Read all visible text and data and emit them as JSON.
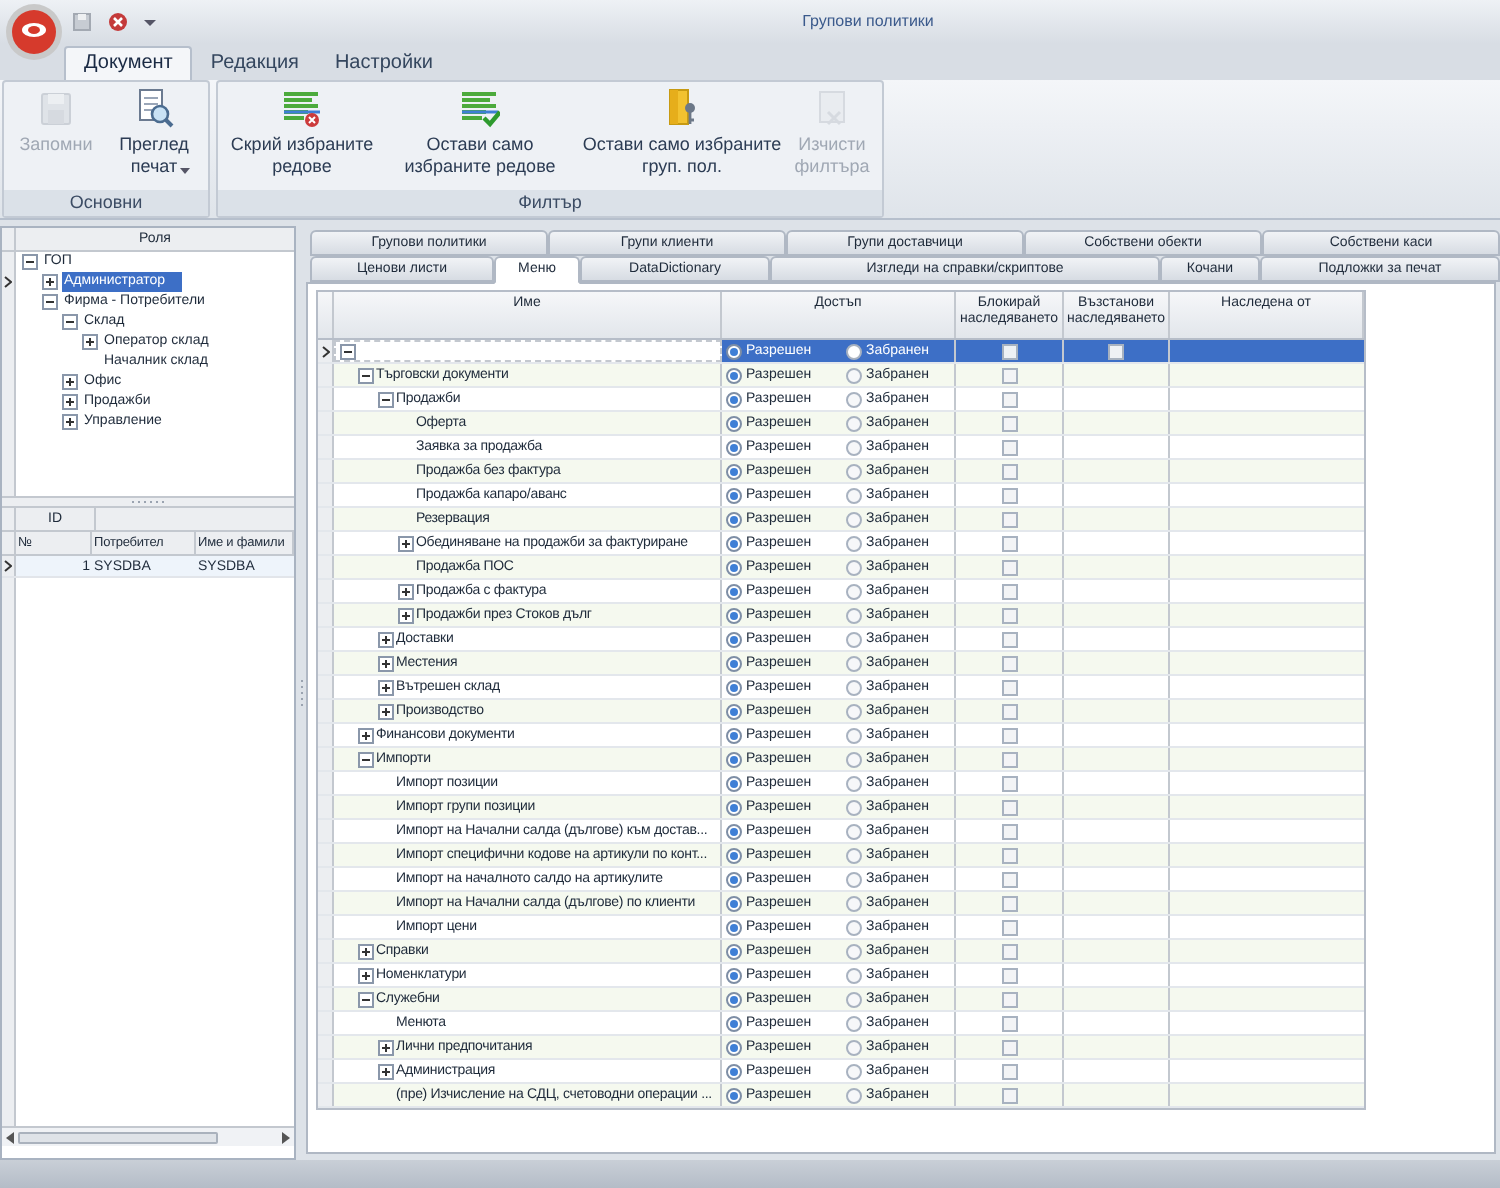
{
  "window": {
    "title": "Групови политики"
  },
  "ribbon": {
    "tabs": [
      {
        "label": "Документ",
        "selected": true
      },
      {
        "label": "Редакция",
        "selected": false
      },
      {
        "label": "Настройки",
        "selected": false
      }
    ],
    "groups": [
      {
        "label": "Основни",
        "buttons": [
          {
            "kind": "save",
            "label": "Запомни",
            "disabled": true
          },
          {
            "kind": "preview",
            "label": "Преглед печат",
            "disabled": false,
            "dropdown": true
          }
        ]
      },
      {
        "label": "Филтър",
        "buttons": [
          {
            "kind": "hide",
            "label": "Скрий избраните редове",
            "disabled": false
          },
          {
            "kind": "keep",
            "label": "Остави само избраните редове",
            "disabled": false
          },
          {
            "kind": "keepgroup",
            "label": "Остави само избраните груп. пол.",
            "disabled": false
          },
          {
            "kind": "clear",
            "label": "Изчисти филтъра",
            "disabled": true
          }
        ]
      }
    ]
  },
  "roles": {
    "header": "Роля",
    "items": [
      {
        "label": "ГОП",
        "expanded": true,
        "selected": false,
        "children": [
          {
            "label": "Администратор",
            "expanded": false,
            "selected": true
          },
          {
            "label": "Фирма - Потребители",
            "expanded": true,
            "selected": false,
            "children": [
              {
                "label": "Склад",
                "expanded": true,
                "selected": false,
                "children": [
                  {
                    "label": "Оператор склад",
                    "expanded": false,
                    "selected": false
                  },
                  {
                    "label": "Началник склад",
                    "selected": false
                  }
                ]
              },
              {
                "label": "Офис",
                "expanded": false,
                "selected": false
              },
              {
                "label": "Продажби",
                "expanded": false,
                "selected": false
              },
              {
                "label": "Управление",
                "expanded": false,
                "selected": false
              }
            ]
          }
        ]
      }
    ]
  },
  "users": {
    "band": "ID",
    "columns": [
      "№",
      "Потребител",
      "Име и фамили"
    ],
    "rows": [
      {
        "cells": [
          "1",
          "SYSDBA",
          "SYSDBA"
        ],
        "selected": true
      }
    ]
  },
  "tab_rows": [
    [
      {
        "label": "Групови политики",
        "selected": false
      },
      {
        "label": "Групи клиенти",
        "selected": false
      },
      {
        "label": "Групи доставчици",
        "selected": false
      },
      {
        "label": "Собствени обекти",
        "selected": false
      },
      {
        "label": "Собствени каси",
        "selected": false
      }
    ],
    [
      {
        "label": "Ценови листи",
        "selected": false
      },
      {
        "label": "Меню",
        "selected": true
      },
      {
        "label": "DataDictionary",
        "selected": false
      },
      {
        "label": "Изгледи на справки/скриптове",
        "selected": false
      },
      {
        "label": "Кочани",
        "selected": false
      },
      {
        "label": "Подложки за печат",
        "selected": false
      }
    ]
  ],
  "grid": {
    "columns": [
      "Име",
      "Достъп",
      "Блокирай наследяването",
      "Възстанови наследяването",
      "Наследена от"
    ],
    "rows": [
      {
        "expanded": true,
        "selected": true,
        "access": [
          {
            "label": "Разрешен",
            "selected": true
          },
          {
            "label": "Забранен",
            "selected": false
          }
        ],
        "block_inheritance": false,
        "restore_inheritance": false,
        "children": [
          {
            "label": "Търговски документи",
            "expanded": true,
            "selected": false,
            "access": [
              {
                "label": "Разрешен",
                "selected": true
              },
              {
                "label": "Забранен",
                "selected": false
              }
            ],
            "block_inheritance": false,
            "children": [
              {
                "label": "Продажби",
                "expanded": true,
                "selected": false,
                "access": [
                  {
                    "label": "Разрешен",
                    "selected": true
                  },
                  {
                    "label": "Забранен",
                    "selected": false
                  }
                ],
                "block_inheritance": false,
                "children": [
                  {
                    "label": "Оферта",
                    "selected": false,
                    "access": [
                      {
                        "label": "Разрешен",
                        "selected": true
                      },
                      {
                        "label": "Забранен",
                        "selected": false
                      }
                    ],
                    "block_inheritance": false
                  },
                  {
                    "label": "Заявка за продажба",
                    "selected": false,
                    "access": [
                      {
                        "label": "Разрешен",
                        "selected": true
                      },
                      {
                        "label": "Забранен",
                        "selected": false
                      }
                    ],
                    "block_inheritance": false
                  },
                  {
                    "label": "Продажба без фактура",
                    "selected": false,
                    "access": [
                      {
                        "label": "Разрешен",
                        "selected": true
                      },
                      {
                        "label": "Забранен",
                        "selected": false
                      }
                    ],
                    "block_inheritance": false
                  },
                  {
                    "label": "Продажба капаро/аванс",
                    "selected": false,
                    "access": [
                      {
                        "label": "Разрешен",
                        "selected": true
                      },
                      {
                        "label": "Забранен",
                        "selected": false
                      }
                    ],
                    "block_inheritance": false
                  },
                  {
                    "label": "Резервация",
                    "selected": false,
                    "access": [
                      {
                        "label": "Разрешен",
                        "selected": true
                      },
                      {
                        "label": "Забранен",
                        "selected": false
                      }
                    ],
                    "block_inheritance": false
                  },
                  {
                    "label": "Обединяване на продажби за фактуриране",
                    "expanded": false,
                    "selected": false,
                    "access": [
                      {
                        "label": "Разрешен",
                        "selected": true
                      },
                      {
                        "label": "Забранен",
                        "selected": false
                      }
                    ],
                    "block_inheritance": false
                  },
                  {
                    "label": "Продажба ПОС",
                    "selected": false,
                    "access": [
                      {
                        "label": "Разрешен",
                        "selected": true
                      },
                      {
                        "label": "Забранен",
                        "selected": false
                      }
                    ],
                    "block_inheritance": false
                  },
                  {
                    "label": "Продажба с фактура",
                    "expanded": false,
                    "selected": false,
                    "access": [
                      {
                        "label": "Разрешен",
                        "selected": true
                      },
                      {
                        "label": "Забранен",
                        "selected": false
                      }
                    ],
                    "block_inheritance": false
                  },
                  {
                    "label": "Продажби през Стоков дълг",
                    "expanded": false,
                    "selected": false,
                    "access": [
                      {
                        "label": "Разрешен",
                        "selected": true
                      },
                      {
                        "label": "Забранен",
                        "selected": false
                      }
                    ],
                    "block_inheritance": false
                  }
                ]
              },
              {
                "label": "Доставки",
                "expanded": false,
                "selected": false,
                "access": [
                  {
                    "label": "Разрешен",
                    "selected": true
                  },
                  {
                    "label": "Забранен",
                    "selected": false
                  }
                ],
                "block_inheritance": false
              },
              {
                "label": "Местения",
                "expanded": false,
                "selected": false,
                "access": [
                  {
                    "label": "Разрешен",
                    "selected": true
                  },
                  {
                    "label": "Забранен",
                    "selected": false
                  }
                ],
                "block_inheritance": false
              },
              {
                "label": "Вътрешен склад",
                "expanded": false,
                "selected": false,
                "access": [
                  {
                    "label": "Разрешен",
                    "selected": true
                  },
                  {
                    "label": "Забранен",
                    "selected": false
                  }
                ],
                "block_inheritance": false
              },
              {
                "label": "Производство",
                "expanded": false,
                "selected": false,
                "access": [
                  {
                    "label": "Разрешен",
                    "selected": true
                  },
                  {
                    "label": "Забранен",
                    "selected": false
                  }
                ],
                "block_inheritance": false
              }
            ]
          },
          {
            "label": "Финансови документи",
            "expanded": false,
            "selected": false,
            "access": [
              {
                "label": "Разрешен",
                "selected": true
              },
              {
                "label": "Забранен",
                "selected": false
              }
            ],
            "block_inheritance": false
          },
          {
            "label": "Импорти",
            "expanded": true,
            "selected": false,
            "access": [
              {
                "label": "Разрешен",
                "selected": true
              },
              {
                "label": "Забранен",
                "selected": false
              }
            ],
            "block_inheritance": false,
            "children": [
              {
                "label": "Импорт позиции",
                "selected": false,
                "access": [
                  {
                    "label": "Разрешен",
                    "selected": true
                  },
                  {
                    "label": "Забранен",
                    "selected": false
                  }
                ],
                "block_inheritance": false
              },
              {
                "label": "Импорт групи позиции",
                "selected": false,
                "access": [
                  {
                    "label": "Разрешен",
                    "selected": true
                  },
                  {
                    "label": "Забранен",
                    "selected": false
                  }
                ],
                "block_inheritance": false
              },
              {
                "label": "Импорт на Начални салда (дългове) към достав...",
                "selected": false,
                "access": [
                  {
                    "label": "Разрешен",
                    "selected": true
                  },
                  {
                    "label": "Забранен",
                    "selected": false
                  }
                ],
                "block_inheritance": false
              },
              {
                "label": "Импорт специфични кодове на артикули по конт...",
                "selected": false,
                "access": [
                  {
                    "label": "Разрешен",
                    "selected": true
                  },
                  {
                    "label": "Забранен",
                    "selected": false
                  }
                ],
                "block_inheritance": false
              },
              {
                "label": "Импорт на началното салдо на артикулите",
                "selected": false,
                "access": [
                  {
                    "label": "Разрешен",
                    "selected": true
                  },
                  {
                    "label": "Забранен",
                    "selected": false
                  }
                ],
                "block_inheritance": false
              },
              {
                "label": "Импорт на Начални салда (дългове) по клиенти",
                "selected": false,
                "access": [
                  {
                    "label": "Разрешен",
                    "selected": true
                  },
                  {
                    "label": "Забранен",
                    "selected": false
                  }
                ],
                "block_inheritance": false
              },
              {
                "label": "Импорт цени",
                "selected": false,
                "access": [
                  {
                    "label": "Разрешен",
                    "selected": true
                  },
                  {
                    "label": "Забранен",
                    "selected": false
                  }
                ],
                "block_inheritance": false
              }
            ]
          },
          {
            "label": "Справки",
            "expanded": false,
            "selected": false,
            "access": [
              {
                "label": "Разрешен",
                "selected": true
              },
              {
                "label": "Забранен",
                "selected": false
              }
            ],
            "block_inheritance": false
          },
          {
            "label": "Номенклатури",
            "expanded": false,
            "selected": false,
            "access": [
              {
                "label": "Разрешен",
                "selected": true
              },
              {
                "label": "Забранен",
                "selected": false
              }
            ],
            "block_inheritance": false
          },
          {
            "label": "Служебни",
            "expanded": true,
            "selected": false,
            "access": [
              {
                "label": "Разрешен",
                "selected": true
              },
              {
                "label": "Забранен",
                "selected": false
              }
            ],
            "block_inheritance": false,
            "children": [
              {
                "label": "Менюта",
                "selected": false,
                "access": [
                  {
                    "label": "Разрешен",
                    "selected": true
                  },
                  {
                    "label": "Забранен",
                    "selected": false
                  }
                ],
                "block_inheritance": false
              },
              {
                "label": "Лични предпочитания",
                "expanded": false,
                "selected": false,
                "access": [
                  {
                    "label": "Разрешен",
                    "selected": true
                  },
                  {
                    "label": "Забранен",
                    "selected": false
                  }
                ],
                "block_inheritance": false
              },
              {
                "label": "Администрация",
                "expanded": false,
                "selected": false,
                "access": [
                  {
                    "label": "Разрешен",
                    "selected": true
                  },
                  {
                    "label": "Забранен",
                    "selected": false
                  }
                ],
                "block_inheritance": false
              },
              {
                "label": "(пре) Изчисление на СДЦ, счетоводни операции ...",
                "selected": false,
                "access": [
                  {
                    "label": "Разрешен",
                    "selected": true
                  },
                  {
                    "label": "Забранен",
                    "selected": false
                  }
                ],
                "block_inheritance": false
              }
            ]
          }
        ]
      }
    ]
  }
}
